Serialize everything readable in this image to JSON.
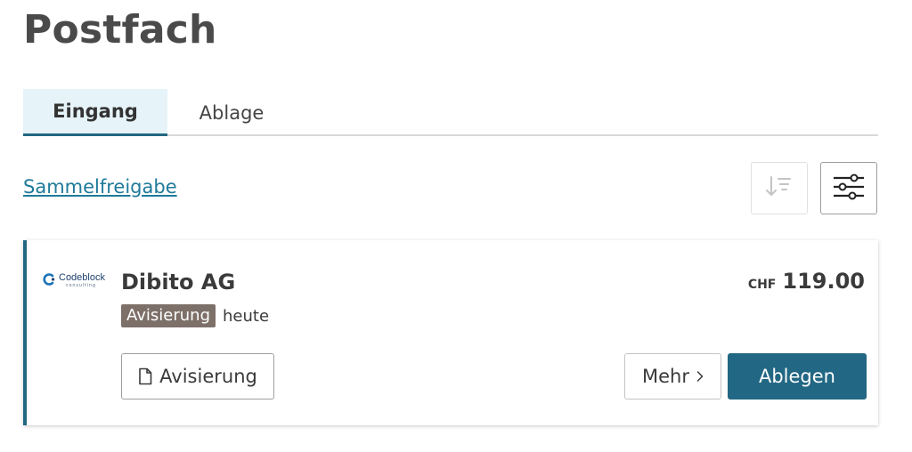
{
  "page": {
    "title": "Postfach"
  },
  "tabs": [
    {
      "label": "Eingang",
      "active": true
    },
    {
      "label": "Ablage",
      "active": false
    }
  ],
  "toolbar": {
    "bulk_release_label": "Sammelfreigabe",
    "sort_icon": "sort-descending-icon",
    "filter_icon": "sliders-filter-icon"
  },
  "item": {
    "logo": {
      "name": "Codeblock",
      "sub": "consulting"
    },
    "company": "Dibito AG",
    "currency": "CHF",
    "amount": "119.00",
    "badge": "Avisierung",
    "date": "heute",
    "doc_button_label": "Avisierung",
    "more_button_label": "Mehr",
    "file_button_label": "Ablegen"
  },
  "colors": {
    "accent": "#226783",
    "link": "#1f7a9a",
    "badge": "#7d7069",
    "tab_active_bg": "#e6f3f8"
  }
}
